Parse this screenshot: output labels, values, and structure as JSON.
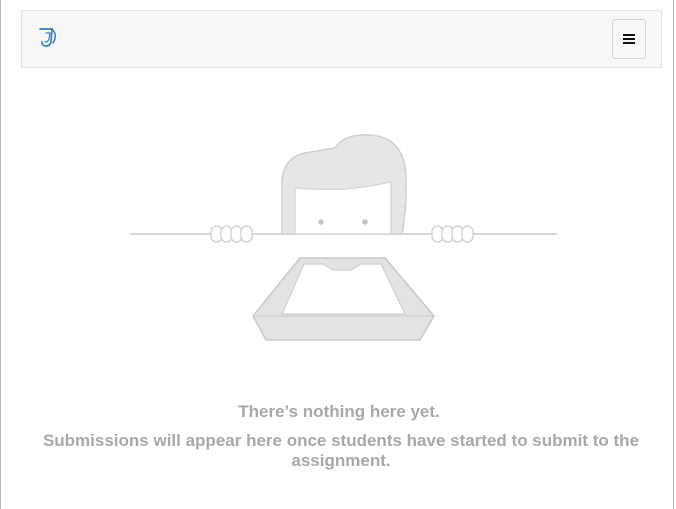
{
  "header": {
    "logo_icon": "canvas-brand-logo-icon",
    "menu_icon": "hamburger-menu-icon",
    "accent_color": "#3a7ebf"
  },
  "empty_state": {
    "illustration": "no-submissions-illustration",
    "title": "There’s nothing here yet.",
    "message": "Submissions will appear here once students have started to submit to the assignment."
  },
  "colors": {
    "text_muted": "#a8a8a8",
    "illustration_fill": "#e4e4e4",
    "illustration_stroke": "#c8c8c8"
  }
}
